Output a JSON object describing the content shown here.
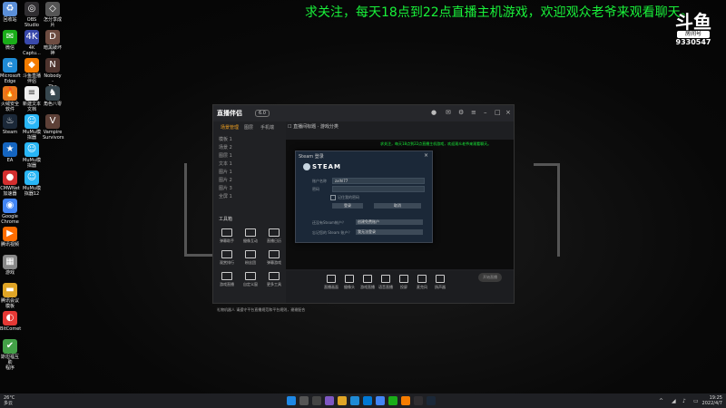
{
  "banner": "求关注，每天18点到22点直播主机游戏，欢迎观众老爷来观看聊天。",
  "douyu": {
    "logo": "斗鱼",
    "tag": "房间号",
    "room": "9330547"
  },
  "desktop_icons_col1": [
    {
      "label": "回收站",
      "icon": "recycle-bin-icon",
      "color": "#5b8fd8",
      "glyph": "♻"
    },
    {
      "label": "微信",
      "icon": "wechat-icon",
      "color": "#1aad19",
      "glyph": "✉"
    },
    {
      "label": "Microsoft\nEdge",
      "icon": "edge-icon",
      "color": "#1f8bd6",
      "glyph": "e"
    },
    {
      "label": "火绒安全软件",
      "icon": "huorong-icon",
      "color": "#e8781d",
      "glyph": "🔥"
    },
    {
      "label": "Steam",
      "icon": "steam-icon",
      "color": "#1b2838",
      "glyph": "♨"
    },
    {
      "label": "EA",
      "icon": "ea-icon",
      "color": "#1565c0",
      "glyph": "★"
    },
    {
      "label": "CMWNet\n加速器",
      "icon": "cmwnet-icon",
      "color": "#d32f2f",
      "glyph": "●"
    },
    {
      "label": "Google\nChrome",
      "icon": "chrome-icon",
      "color": "#4285f4",
      "glyph": "◉"
    },
    {
      "label": "腾讯视频",
      "icon": "tencent-video-icon",
      "color": "#ff6d00",
      "glyph": "▶"
    },
    {
      "label": "游戏",
      "icon": "game-icon",
      "color": "#888888",
      "glyph": "▦"
    },
    {
      "label": "腾讯会议模板",
      "icon": "folder-icon",
      "color": "#e0a526",
      "glyph": "▬"
    },
    {
      "label": "BitComet",
      "icon": "bitcomet-icon",
      "color": "#e53935",
      "glyph": "◐"
    },
    {
      "label": "斯坦福互助\n程序",
      "icon": "app-icon",
      "color": "#43a047",
      "glyph": "✔"
    }
  ],
  "desktop_icons_col2": [
    {
      "label": "OBS\nStudio",
      "icon": "obs-icon",
      "color": "#302e31",
      "glyph": "◎"
    },
    {
      "label": "4K\nCaptu...",
      "icon": "capture-icon",
      "color": "#3949ab",
      "glyph": "4K"
    },
    {
      "label": "斗鱼直播伴侣",
      "icon": "douyu-icon",
      "color": "#f57c00",
      "glyph": "◆"
    },
    {
      "label": "新建文本\n文档",
      "icon": "text-doc-icon",
      "color": "#eeeeee",
      "glyph": "≡"
    },
    {
      "label": "MuMu模\n拟器",
      "icon": "mumu-icon",
      "color": "#29b6f6",
      "glyph": "☺"
    },
    {
      "label": "MuMu模\n拟器",
      "icon": "mumu-icon",
      "color": "#29b6f6",
      "glyph": "☺"
    },
    {
      "label": "MuMu模\n拟器12",
      "icon": "mumu-icon",
      "color": "#29b6f6",
      "glyph": "☺"
    }
  ],
  "desktop_icons_col3": [
    {
      "label": "怎分享成片",
      "icon": "share-icon",
      "color": "#555555",
      "glyph": "◇"
    },
    {
      "label": "暗黑破坏神",
      "icon": "diablo-icon",
      "color": "#6d4c41",
      "glyph": "D"
    },
    {
      "label": "Nobody -\nThe Turn...",
      "icon": "game-icon",
      "color": "#4e342e",
      "glyph": "N"
    },
    {
      "label": "角色八零",
      "icon": "game-icon",
      "color": "#37474f",
      "glyph": "♞"
    },
    {
      "label": "Vampire\nSurvivors",
      "icon": "game-icon",
      "color": "#5d4037",
      "glyph": "V"
    }
  ],
  "app": {
    "name": "直播伴侣",
    "version": "6.0",
    "left_tabs": [
      "场景管理",
      "图层",
      "手机端"
    ],
    "scenes": [
      "模板 1",
      "场景 2",
      "图层 1",
      "文本 1",
      "图片 1",
      "图片 2",
      "图片 3",
      "全屏 1"
    ],
    "toolbox_title": "工具箱",
    "tools": [
      "弹幕助手",
      "摄像互动",
      "直播日历",
      "观赏排行",
      "粉丝团",
      "弹幕游戏",
      "游戏直播",
      "自定义窗",
      "更多工具"
    ],
    "notice": "礼物机器人  请遵守平台直播规范和平台规则，谢谢配合",
    "preview_header": "☐ 直播间标题 · 游戏分类",
    "preview_banner": "求关注，每天18点到22点直播主机游戏，欢迎观众老爷来观看聊天。",
    "bottom": [
      "直播画面",
      "摄像头",
      "游戏直播",
      "语音直播",
      "投屏",
      "麦克风",
      "扬声器"
    ],
    "start_live": "开始直播"
  },
  "steam": {
    "title": "Steam 登录",
    "brand": "STEAM",
    "account_label": "账户名称",
    "account_value": "zxlhl77",
    "password_label": "密码",
    "remember": "记住我的密码",
    "login_btn": "登录",
    "cancel_btn": "取消",
    "q1": "还没有Steam帐户？",
    "q1_btn": "创建免费账户",
    "q2": "忘记您的 Steam 账户？",
    "q2_btn": "我无法登录"
  },
  "taskbar": {
    "weather_temp": "26°C",
    "weather_text": "多云",
    "time": "19:25",
    "date": "2022/4/7"
  }
}
